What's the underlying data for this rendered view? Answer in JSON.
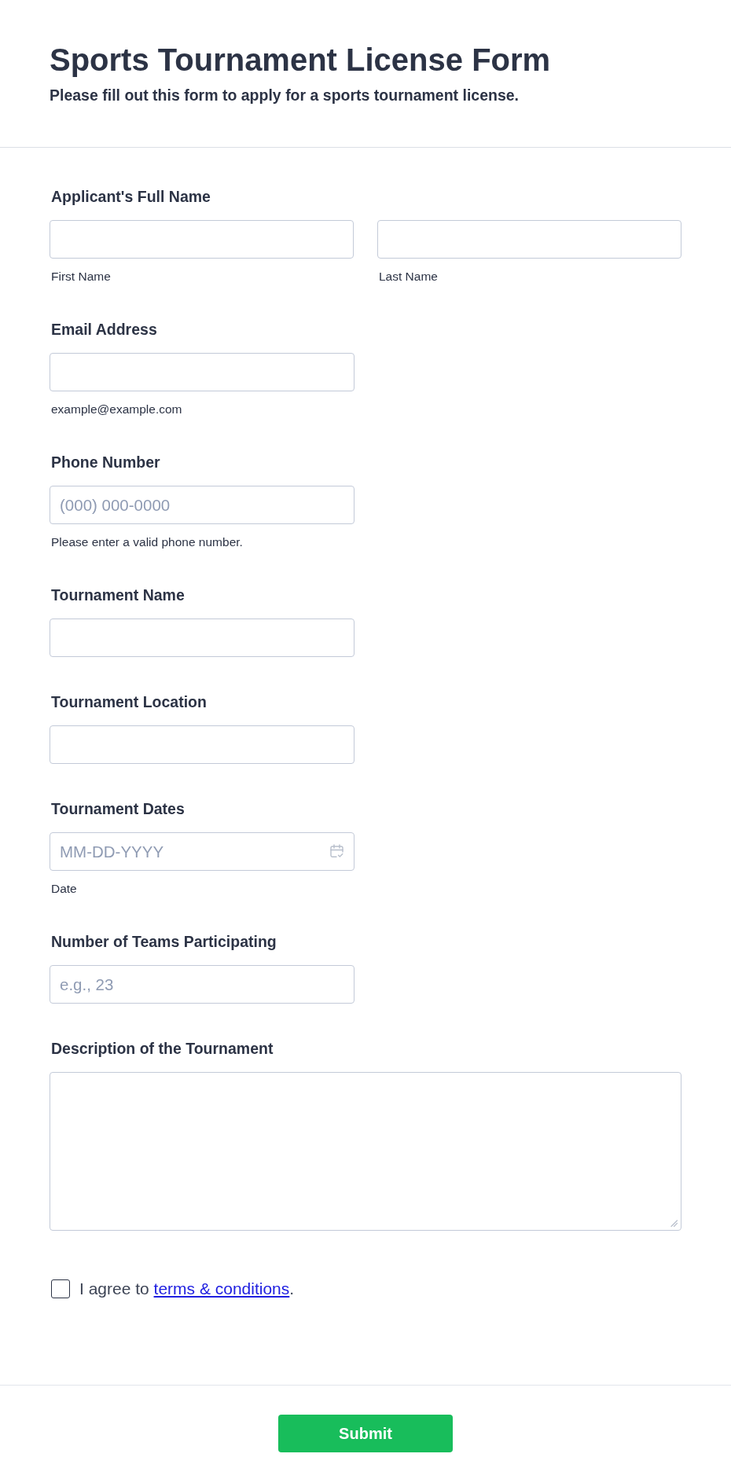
{
  "header": {
    "title": "Sports Tournament License Form",
    "subtitle": "Please fill out this form to apply for a sports tournament license."
  },
  "fields": [
    {
      "kind": "name_pair",
      "label": "Applicant's Full Name",
      "parts": [
        {
          "sublabel": "First Name"
        },
        {
          "sublabel": "Last Name"
        }
      ]
    },
    {
      "kind": "text",
      "label": "Email Address",
      "helper": "example@example.com"
    },
    {
      "kind": "text",
      "label": "Phone Number",
      "placeholder": "(000) 000-0000",
      "helper": "Please enter a valid phone number."
    },
    {
      "kind": "text",
      "label": "Tournament Name"
    },
    {
      "kind": "text",
      "label": "Tournament Location"
    },
    {
      "kind": "date",
      "label": "Tournament Dates",
      "placeholder": "MM-DD-YYYY",
      "helper": "Date"
    },
    {
      "kind": "text",
      "label": "Number of Teams Participating",
      "placeholder": "e.g., 23"
    },
    {
      "kind": "textarea",
      "label": "Description of the Tournament"
    }
  ],
  "agreement": {
    "checked": false,
    "text_before": "I agree to ",
    "link": "terms & conditions",
    "text_after": "."
  },
  "submit_button": {
    "label": "Submit"
  }
}
